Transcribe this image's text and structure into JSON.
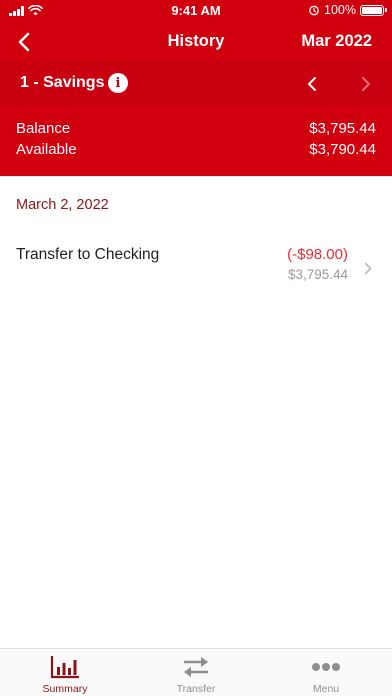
{
  "status_bar": {
    "time": "9:41 AM",
    "battery": "100%"
  },
  "nav": {
    "title": "History",
    "period": "Mar 2022",
    "back_icon": "chevron-left-icon"
  },
  "account": {
    "name": "1 - Savings",
    "info_icon": "info-icon",
    "info_glyph": "i"
  },
  "balances": {
    "balance_label": "Balance",
    "balance_value": "$3,795.44",
    "available_label": "Available",
    "available_value": "$3,790.44"
  },
  "transactions": {
    "date": "March 2, 2022",
    "items": [
      {
        "description": "Transfer to Checking",
        "amount": "(-$98.00)",
        "running_balance": "$3,795.44"
      }
    ]
  },
  "tabs": [
    {
      "label": "Summary",
      "icon": "bar-chart-icon",
      "active": true
    },
    {
      "label": "Transfer",
      "icon": "transfer-arrows-icon",
      "active": false
    },
    {
      "label": "Menu",
      "icon": "more-dots-icon",
      "active": false
    }
  ],
  "colors": {
    "brand_red": "#d0000f",
    "accent_dark_red": "#8a1418",
    "debit_red": "#e42e38",
    "inactive_gray": "#8e8e8e"
  }
}
